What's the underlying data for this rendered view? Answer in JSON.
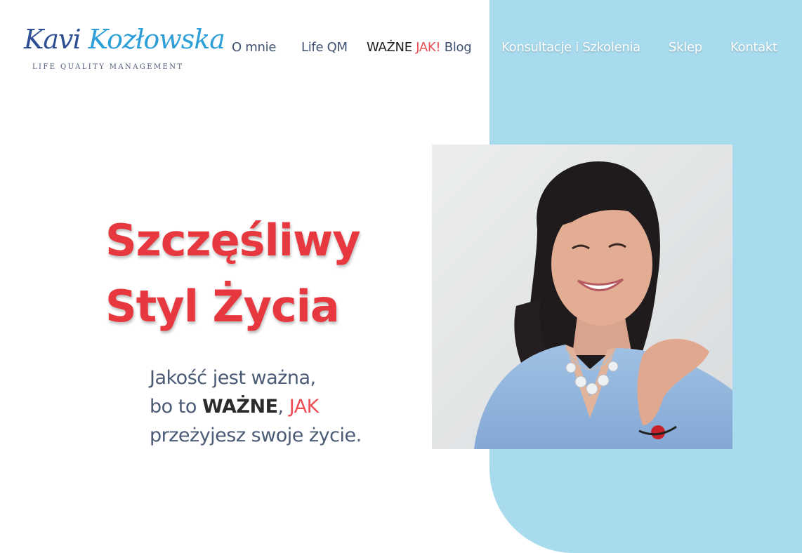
{
  "brand": {
    "name_part1": "Kavi ",
    "name_part2": "Kozłowska",
    "tagline": "LIFE QUALITY MANAGEMENT"
  },
  "nav": {
    "about": "O mnie",
    "life_qm": "Life QM",
    "blog_wazne": "WAŻNE",
    "blog_jak": "JAK!",
    "blog_label": "Blog",
    "consulting": "Konsultacje i Szkolenia",
    "shop": "Sklep",
    "contact": "Kontakt"
  },
  "hero": {
    "title_line1": "Szczęśliwy",
    "title_line2": "Styl Życia",
    "subtitle_line1": "Jakość jest ważna,",
    "subtitle_line2_prefix": "bo to ",
    "subtitle_line2_wazne": "WAŻNE",
    "subtitle_line2_comma": ", ",
    "subtitle_line2_jak": "JAK",
    "subtitle_line3": "przeżyjesz swoje życie."
  },
  "colors": {
    "accent_red": "#e8383f",
    "panel_blue": "#a8dbed",
    "nav_dark": "#3e5170",
    "logo_blue": "#2f4f95"
  }
}
